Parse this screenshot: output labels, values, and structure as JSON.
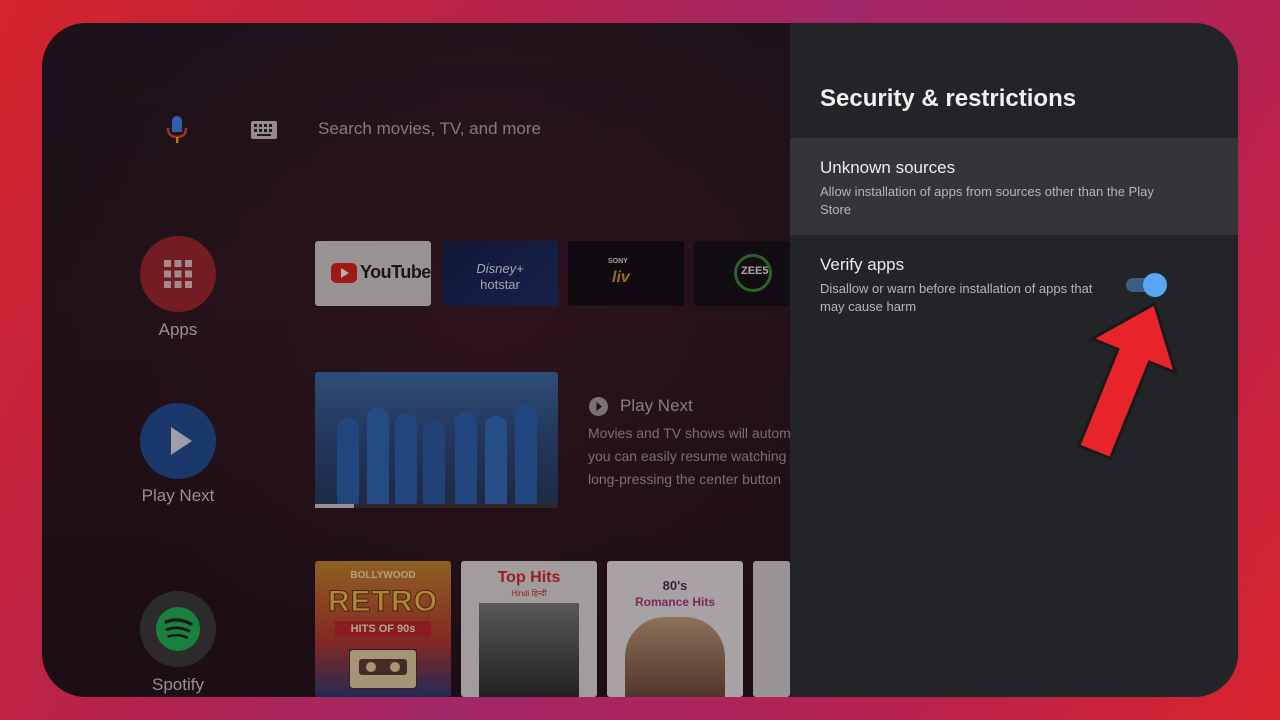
{
  "search": {
    "placeholder": "Search movies, TV, and more"
  },
  "rail": {
    "apps_label": "Apps",
    "playnext_label": "Play Next",
    "spotify_label": "Spotify"
  },
  "channels": {
    "youtube": "YouTube",
    "hotstar_line1": "Disney+",
    "hotstar_line2": "hotstar",
    "sony_line1": "SONY",
    "sony_line2": "liv",
    "zee": "ZEE5"
  },
  "play_next": {
    "title": "Play Next",
    "description_line1": "Movies and TV shows will autom",
    "description_line2": "you can easily resume watching",
    "description_line3": "long-pressing the center button",
    "progress": 0.16
  },
  "music": {
    "tile1_line1": "BOLLYWOOD",
    "tile1_line2": "RETRO",
    "tile1_line3": "HITS OF 90s",
    "tile2_line1": "Top Hits",
    "tile2_line2": "Hindi हिन्दी",
    "tile3_line1": "80's",
    "tile3_line2": "Romance Hits"
  },
  "settings": {
    "title": "Security & restrictions",
    "unknown_sources_title": "Unknown sources",
    "unknown_sources_desc": "Allow installation of apps from sources other than the Play Store",
    "verify_apps_title": "Verify apps",
    "verify_apps_desc": "Disallow or warn before installation of apps that may cause harm",
    "verify_apps_enabled": true
  },
  "colors": {
    "toggle_on": "#58a6f5",
    "annotation_arrow": "#e8232a",
    "frame": "#c4233e"
  }
}
